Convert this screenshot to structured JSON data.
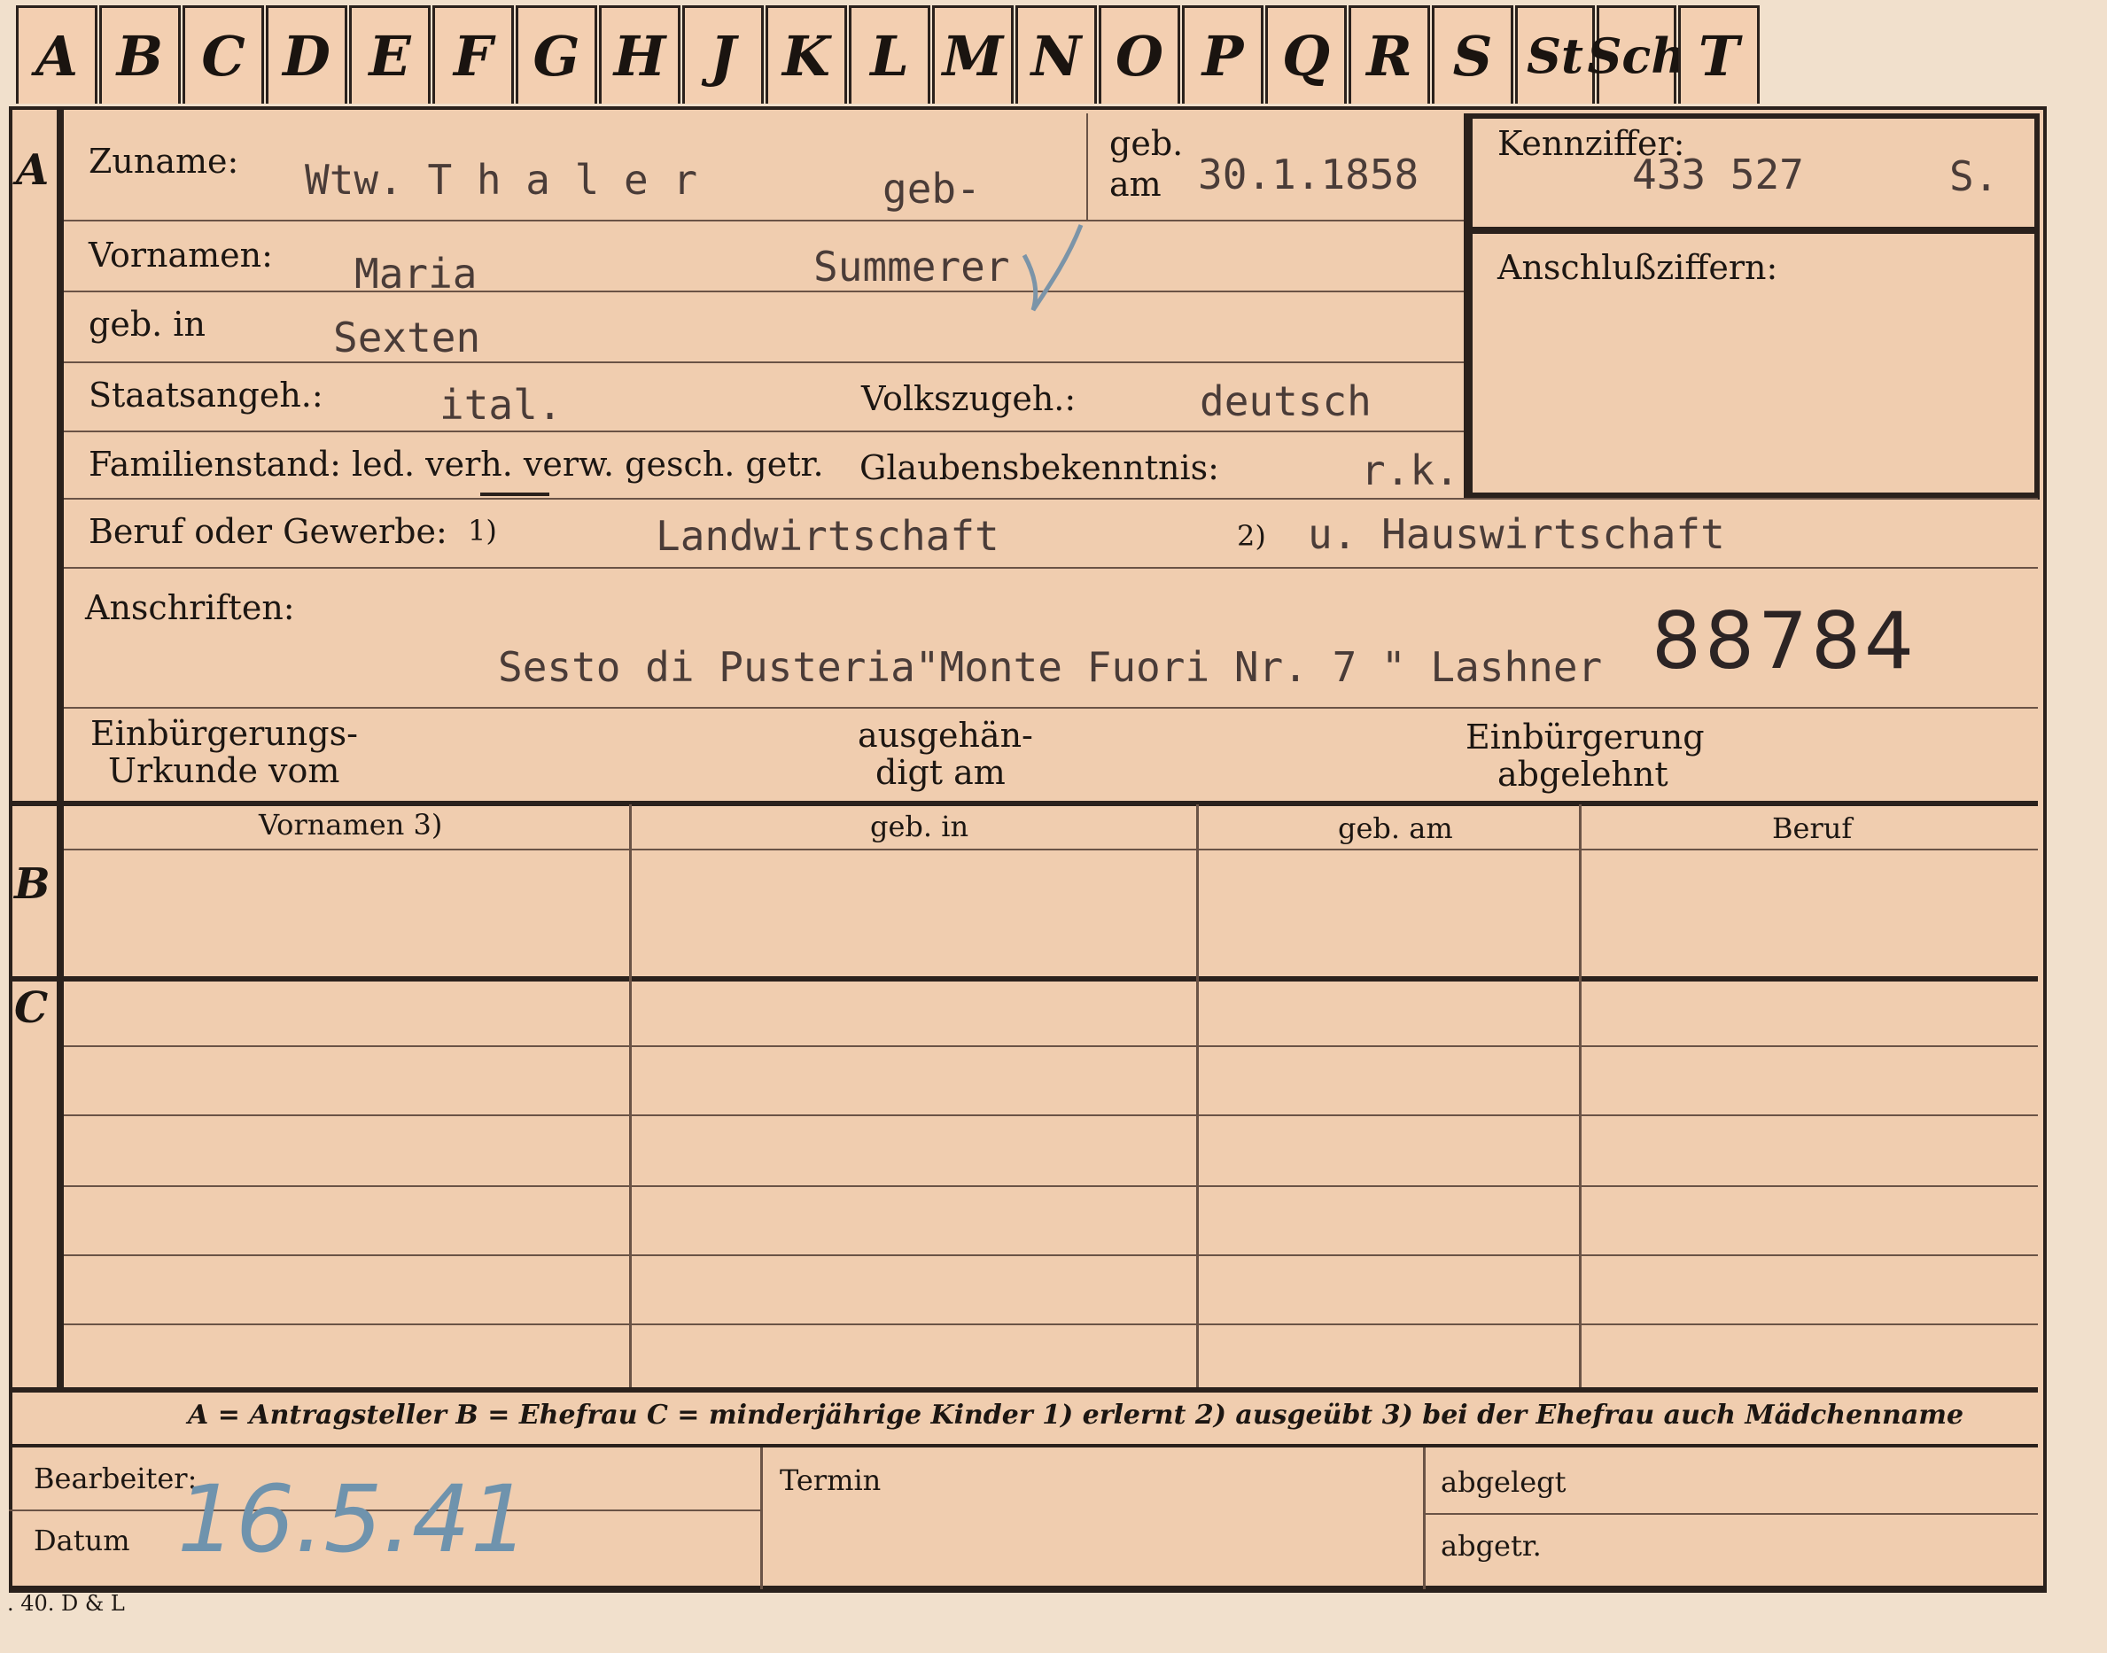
{
  "tabs": [
    "A",
    "B",
    "C",
    "D",
    "E",
    "F",
    "G",
    "H",
    "J",
    "K",
    "L",
    "M",
    "N",
    "O",
    "P",
    "Q",
    "R",
    "S",
    "St",
    "Sch",
    "T"
  ],
  "sections": {
    "a": "A",
    "b": "B",
    "c": "C"
  },
  "labels": {
    "zuname": "Zuname:",
    "geb_am_1": "geb.",
    "geb_am_2": "am",
    "kennziffer": "Kennziffer:",
    "vornamen": "Vornamen:",
    "anschlussziffern": "Anschlußziffern:",
    "geb_in": "geb. in",
    "staatsangeh": "Staatsangeh.:",
    "volkszugeh": "Volkszugeh.:",
    "familienstand": "Familienstand: led. verh. verw. gesch. getr.",
    "glaubensbekenntnis": "Glaubensbekenntnis:",
    "beruf": "Beruf oder Gewerbe:",
    "fn1": "1)",
    "fn2": "2)",
    "anschriften": "Anschriften:",
    "einb_urkunde_1": "Einbürgerungs-",
    "einb_urkunde_2": "Urkunde vom",
    "ausgehaendigt_1": "ausgehän-",
    "ausgehaendigt_2": "digt am",
    "einb_abgelehnt_1": "Einbürgerung",
    "einb_abgelehnt_2": "abgelehnt"
  },
  "values": {
    "zuname": "Wtw. T h a l e r",
    "geb_prefix": "geb-",
    "geb_am": "30.1.1858",
    "kennziffer": "433 527",
    "kennziffer_suffix": "S.",
    "vornamen": "Maria",
    "maiden_name": "Summerer",
    "geb_in": "Sexten",
    "staatsangeh": "ital.",
    "volkszugeh": "deutsch",
    "glaubensbekenntnis": "r.k.",
    "beruf_1": "Landwirtschaft",
    "beruf_2": "u. Hauswirtschaft",
    "anschrift": "Sesto di Pusteria\"Monte Fuori Nr. 7 \" Lashner",
    "stamp_number": "88784"
  },
  "table": {
    "headers": [
      "Vornamen 3)",
      "geb. in",
      "geb. am",
      "Beruf"
    ]
  },
  "legend": "A = Antragsteller   B = Ehefrau   C = minderjährige Kinder   1) erlernt   2) ausgeübt   3) bei der Ehefrau auch Mädchenname",
  "footer": {
    "bearbeiter": "Bearbeiter:",
    "datum": "Datum",
    "datum_value": "16.5.41",
    "termin": "Termin",
    "abgelegt": "abgelegt",
    "abgetr": "abgetr."
  },
  "print_code": ". 40. D & L"
}
